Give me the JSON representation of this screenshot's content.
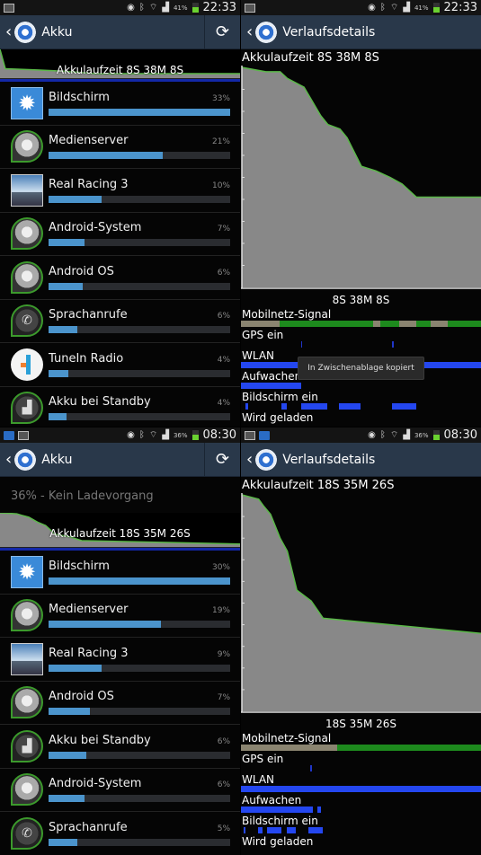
{
  "screens": [
    {
      "id": "tl",
      "status_bar": {
        "left_icons": [
          "image-icon"
        ],
        "right_icons": [
          "eye-icon",
          "bluetooth-icon",
          "wifi-icon",
          "signal-icon"
        ],
        "battery_pct": "41%",
        "time": "22:33"
      },
      "action_bar": {
        "title": "Akku",
        "has_refresh": true
      },
      "summary": {
        "status_line": null,
        "label": "Akkulaufzeit 8S 38M 8S"
      },
      "items": [
        {
          "name": "Bildschirm",
          "percent": "33%",
          "fill": 1.0,
          "icon": "brightness-icon"
        },
        {
          "name": "Medienserver",
          "percent": "21%",
          "fill": 0.63,
          "icon": "android-process-icon"
        },
        {
          "name": "Real Racing 3",
          "percent": "10%",
          "fill": 0.29,
          "icon": "real-racing-app-icon"
        },
        {
          "name": "Android-System",
          "percent": "7%",
          "fill": 0.2,
          "icon": "android-process-icon"
        },
        {
          "name": "Android OS",
          "percent": "6%",
          "fill": 0.19,
          "icon": "android-process-icon"
        },
        {
          "name": "Sprachanrufe",
          "percent": "6%",
          "fill": 0.16,
          "icon": "phone-icon"
        },
        {
          "name": "TuneIn Radio",
          "percent": "4%",
          "fill": 0.11,
          "icon": "tunein-app-icon"
        },
        {
          "name": "Akku bei Standby",
          "percent": "4%",
          "fill": 0.1,
          "icon": "signal-standby-icon"
        }
      ]
    },
    {
      "id": "tr",
      "status_bar": {
        "left_icons": [
          "image-icon"
        ],
        "right_icons": [
          "eye-icon",
          "bluetooth-icon",
          "wifi-icon",
          "signal-icon"
        ],
        "battery_pct": "41%",
        "time": "22:33"
      },
      "action_bar": {
        "title": "Verlaufsdetails",
        "has_refresh": false
      },
      "history": {
        "title": "Akkulaufzeit 8S 38M 8S",
        "x_label": "8S 38M 8S",
        "tracks": [
          "Mobilnetz-Signal",
          "GPS ein",
          "WLAN",
          "Aufwachen",
          "Bildschirm ein",
          "Wird geladen"
        ]
      },
      "toast": "In Zwischenablage kopiert"
    },
    {
      "id": "bl",
      "status_bar": {
        "left_icons": [
          "outlook-icon",
          "image-icon"
        ],
        "right_icons": [
          "eye-icon",
          "bluetooth-icon",
          "wifi-icon",
          "signal-icon"
        ],
        "battery_pct": "36%",
        "time": "08:30"
      },
      "action_bar": {
        "title": "Akku",
        "has_refresh": true
      },
      "summary": {
        "status_line": "36% - Kein Ladevorgang",
        "label": "Akkulaufzeit 18S 35M 26S"
      },
      "items": [
        {
          "name": "Bildschirm",
          "percent": "30%",
          "fill": 1.0,
          "icon": "brightness-icon"
        },
        {
          "name": "Medienserver",
          "percent": "19%",
          "fill": 0.62,
          "icon": "android-process-icon"
        },
        {
          "name": "Real Racing 3",
          "percent": "9%",
          "fill": 0.29,
          "icon": "real-racing-app-icon"
        },
        {
          "name": "Android OS",
          "percent": "7%",
          "fill": 0.23,
          "icon": "android-process-icon"
        },
        {
          "name": "Akku bei Standby",
          "percent": "6%",
          "fill": 0.21,
          "icon": "signal-standby-icon"
        },
        {
          "name": "Android-System",
          "percent": "6%",
          "fill": 0.2,
          "icon": "android-process-icon"
        },
        {
          "name": "Sprachanrufe",
          "percent": "5%",
          "fill": 0.16,
          "icon": "phone-icon"
        }
      ]
    },
    {
      "id": "br",
      "status_bar": {
        "left_icons": [
          "image-icon",
          "outlook-icon"
        ],
        "right_icons": [
          "eye-icon",
          "bluetooth-icon",
          "wifi-icon",
          "signal-icon"
        ],
        "battery_pct": "36%",
        "time": "08:30"
      },
      "action_bar": {
        "title": "Verlaufsdetails",
        "has_refresh": false
      },
      "history": {
        "title": "Akkulaufzeit 18S 35M 26S",
        "x_label": "18S 35M 26S",
        "tracks": [
          "Mobilnetz-Signal",
          "GPS ein",
          "WLAN",
          "Aufwachen",
          "Bildschirm ein",
          "Wird geladen"
        ]
      }
    }
  ],
  "chart_data": [
    {
      "type": "area",
      "title": "Akkulaufzeit 8S 38M 8S",
      "xlabel": "8S 38M 8S",
      "ylabel": "",
      "x_unit": "fraction of elapsed time",
      "y_unit": "battery %",
      "ylim": [
        0,
        100
      ],
      "x": [
        0,
        0.1,
        0.16,
        0.19,
        0.26,
        0.33,
        0.36,
        0.41,
        0.44,
        0.5,
        0.56,
        0.62,
        0.67,
        0.73,
        1.0
      ],
      "y": [
        100,
        98,
        98,
        95,
        91,
        78,
        74,
        72,
        68,
        55,
        53,
        50,
        47,
        41,
        41
      ],
      "series_color": "#5ab848"
    },
    {
      "type": "area",
      "title": "Akkulaufzeit 18S 35M 26S",
      "xlabel": "18S 35M 26S",
      "ylabel": "",
      "x_unit": "fraction of elapsed time",
      "y_unit": "battery %",
      "ylim": [
        0,
        100
      ],
      "x": [
        0,
        0.07,
        0.09,
        0.12,
        0.16,
        0.19,
        0.23,
        0.29,
        0.34,
        1.0
      ],
      "y": [
        100,
        98,
        95,
        91,
        80,
        74,
        56,
        51,
        43,
        36
      ],
      "series_color": "#5ab848"
    }
  ],
  "timelines": {
    "tr": {
      "Mobilnetz-Signal": [
        [
          0,
          0.16,
          "#8a8470"
        ],
        [
          0.16,
          0.55,
          "#1d8a1d"
        ],
        [
          0.55,
          0.58,
          "#8a8470"
        ],
        [
          0.58,
          0.66,
          "#1d8a1d"
        ],
        [
          0.66,
          0.73,
          "#8a8470"
        ],
        [
          0.73,
          0.79,
          "#1d8a1d"
        ],
        [
          0.79,
          0.86,
          "#8a8470"
        ],
        [
          0.86,
          1.0,
          "#1d8a1d"
        ]
      ],
      "GPS ein": [
        [
          0.25,
          0.255,
          "#2036c8"
        ],
        [
          0.63,
          0.635,
          "#2036c8"
        ]
      ],
      "WLAN": [
        [
          0,
          1.0,
          "#2447f0"
        ]
      ],
      "Aufwachen": [
        [
          0,
          0.25,
          "#2447f0"
        ]
      ],
      "Bildschirm ein": [
        [
          0.02,
          0.03,
          "#2447f0"
        ],
        [
          0.17,
          0.19,
          "#2447f0"
        ],
        [
          0.25,
          0.36,
          "#2447f0"
        ],
        [
          0.41,
          0.5,
          "#2447f0"
        ],
        [
          0.63,
          0.73,
          "#2447f0"
        ]
      ],
      "Wird geladen": []
    },
    "br": {
      "Mobilnetz-Signal": [
        [
          0,
          0.4,
          "#8a8470"
        ],
        [
          0.4,
          1.0,
          "#1d8a1d"
        ]
      ],
      "GPS ein": [
        [
          0.29,
          0.295,
          "#2036c8"
        ]
      ],
      "WLAN": [
        [
          0,
          1.0,
          "#2447f0"
        ]
      ],
      "Aufwachen": [
        [
          0,
          0.3,
          "#2447f0"
        ],
        [
          0.32,
          0.335,
          "#2447f0"
        ]
      ],
      "Bildschirm ein": [
        [
          0.01,
          0.02,
          "#2447f0"
        ],
        [
          0.07,
          0.09,
          "#2447f0"
        ],
        [
          0.11,
          0.17,
          "#2447f0"
        ],
        [
          0.19,
          0.23,
          "#2447f0"
        ],
        [
          0.28,
          0.34,
          "#2447f0"
        ]
      ],
      "Wird geladen": []
    }
  }
}
